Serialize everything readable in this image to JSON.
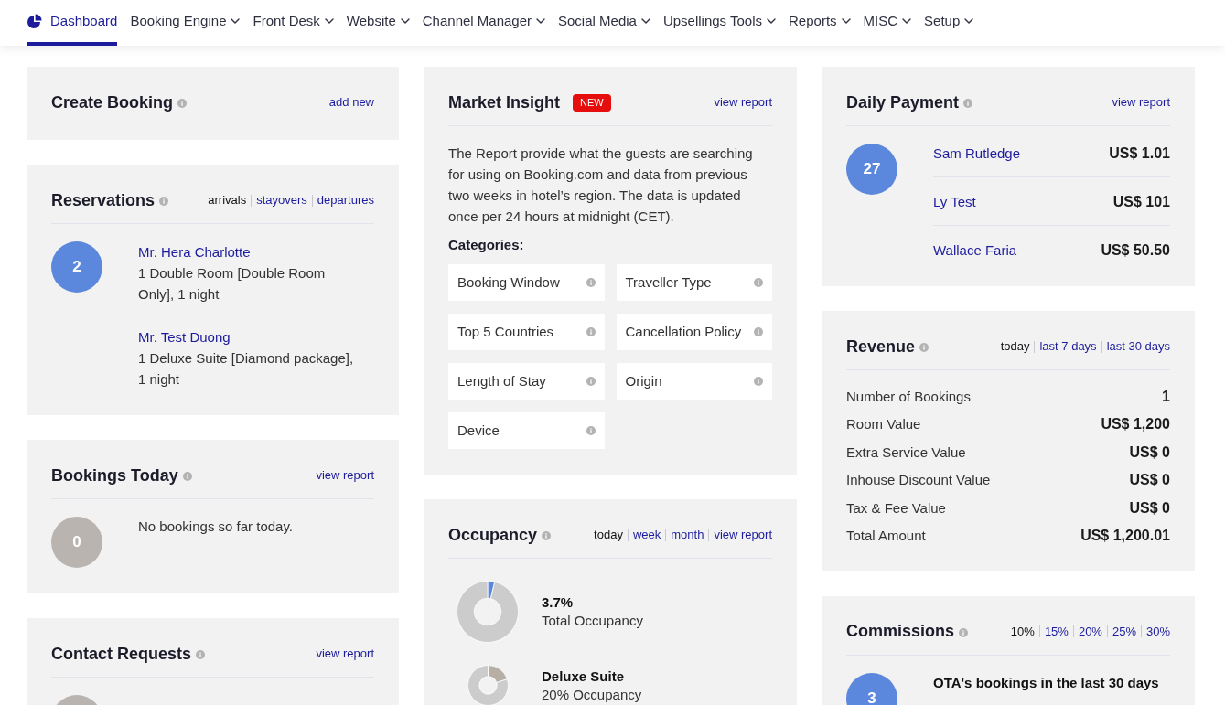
{
  "nav": [
    {
      "label": "Dashboard",
      "kind": "icon",
      "selected": true
    },
    {
      "label": "Booking Engine",
      "kind": "menu",
      "selected": false
    },
    {
      "label": "Front Desk",
      "kind": "menu",
      "selected": false
    },
    {
      "label": "Website",
      "kind": "menu",
      "selected": false
    },
    {
      "label": "Channel Manager",
      "kind": "menu",
      "selected": false
    },
    {
      "label": "Social Media",
      "kind": "menu",
      "selected": false
    },
    {
      "label": "Upsellings Tools",
      "kind": "menu",
      "selected": false
    },
    {
      "label": "Reports",
      "kind": "menu",
      "selected": false
    },
    {
      "label": "MISC",
      "kind": "menu",
      "selected": false
    },
    {
      "label": "Setup",
      "kind": "menu",
      "selected": false
    }
  ],
  "columns": [
    [
      {
        "title": "Create Booking",
        "info": true,
        "links": [
          {
            "label": "add new",
            "selected": false
          }
        ]
      },
      {
        "title": "Reservations",
        "info": true,
        "links": [
          {
            "label": "arrivals",
            "selected": true
          },
          {
            "label": "stayovers",
            "selected": false
          },
          {
            "label": "departures",
            "selected": false
          }
        ],
        "body": {
          "kind": "bookings",
          "count": "2",
          "entries": [
            {
              "name": "Mr. Hera Charlotte",
              "detail": "1 Double Room [Double Room Only], 1 night"
            },
            {
              "name": "Mr. Test Duong",
              "detail": "1 Deluxe Suite [Diamond package], 1 night"
            }
          ]
        }
      },
      {
        "title": "Bookings Today",
        "info": true,
        "links": [
          {
            "label": "view report",
            "selected": false
          }
        ],
        "body": {
          "kind": "empty",
          "count": "0",
          "message": "No bookings so far today."
        }
      },
      {
        "title": "Contact Requests",
        "info": true,
        "links": [
          {
            "label": "view report",
            "selected": false
          }
        ],
        "body": {
          "kind": "empty"
        }
      }
    ],
    [
      {
        "title": "Market Insight",
        "badge": "NEW",
        "links": [
          {
            "label": "view report",
            "selected": false
          }
        ],
        "body": {
          "kind": "insight",
          "text": "The Report provide what the guests are searching for using on Booking.com and data from previous two weeks in hotel’s region. The data is updated once per 24 hours at midnight (CET).",
          "categories_label": "Categories:",
          "categories": [
            "Booking Window",
            "Traveller Type",
            "Top 5 Countries",
            "Cancellation Policy",
            "Length of Stay",
            "Origin",
            "Device"
          ]
        }
      },
      {
        "title": "Occupancy",
        "info": true,
        "links": [
          {
            "label": "today",
            "selected": true
          },
          {
            "label": "week",
            "selected": false
          },
          {
            "label": "month",
            "selected": false
          },
          {
            "label": "view report",
            "selected": false
          }
        ],
        "body": {
          "kind": "occupancy",
          "items": [
            {
              "kind": "total",
              "heading": "3.7%",
              "caption": "Total Occupancy",
              "color": "#5b87dd",
              "chart_data": {
                "type": "donut",
                "values": [
                  3.7,
                  96.3
                ]
              }
            },
            {
              "kind": "room",
              "heading": "Deluxe Suite",
              "caption": "20% Occupancy",
              "color": "#b7afa6",
              "chart_data": {
                "type": "donut",
                "values": [
                  20,
                  80
                ]
              }
            }
          ]
        }
      }
    ],
    [
      {
        "title": "Daily Payment",
        "info": true,
        "links": [
          {
            "label": "view report",
            "selected": false
          }
        ],
        "body": {
          "kind": "payments",
          "count": "27",
          "rows": [
            {
              "name": "Sam Rutledge",
              "amount": "US$ 1.01"
            },
            {
              "name": "Ly Test",
              "amount": "US$ 101"
            },
            {
              "name": "Wallace Faria",
              "amount": "US$ 50.50"
            }
          ]
        }
      },
      {
        "title": "Revenue",
        "info": true,
        "links": [
          {
            "label": "today",
            "selected": true
          },
          {
            "label": "last 7 days",
            "selected": false
          },
          {
            "label": "last 30 days",
            "selected": false
          }
        ],
        "body": {
          "kind": "summary",
          "rows": [
            {
              "label": "Number of Bookings",
              "value": "1"
            },
            {
              "label": "Room Value",
              "value": "US$ 1,200"
            },
            {
              "label": "Extra Service Value",
              "value": "US$ 0"
            },
            {
              "label": "Inhouse Discount Value",
              "value": "US$ 0"
            },
            {
              "label": "Tax & Fee Value",
              "value": "US$ 0"
            },
            {
              "label": "Total Amount",
              "value": "US$ 1,200.01"
            }
          ]
        }
      },
      {
        "title": "Commissions",
        "info": true,
        "links": [
          {
            "label": "10%",
            "selected": true
          },
          {
            "label": "15%",
            "selected": false
          },
          {
            "label": "20%",
            "selected": false
          },
          {
            "label": "25%",
            "selected": false
          },
          {
            "label": "30%",
            "selected": false
          }
        ],
        "body": {
          "kind": "commissions",
          "count": "3",
          "heading": "OTA's bookings in the last 30 days"
        }
      }
    ]
  ]
}
